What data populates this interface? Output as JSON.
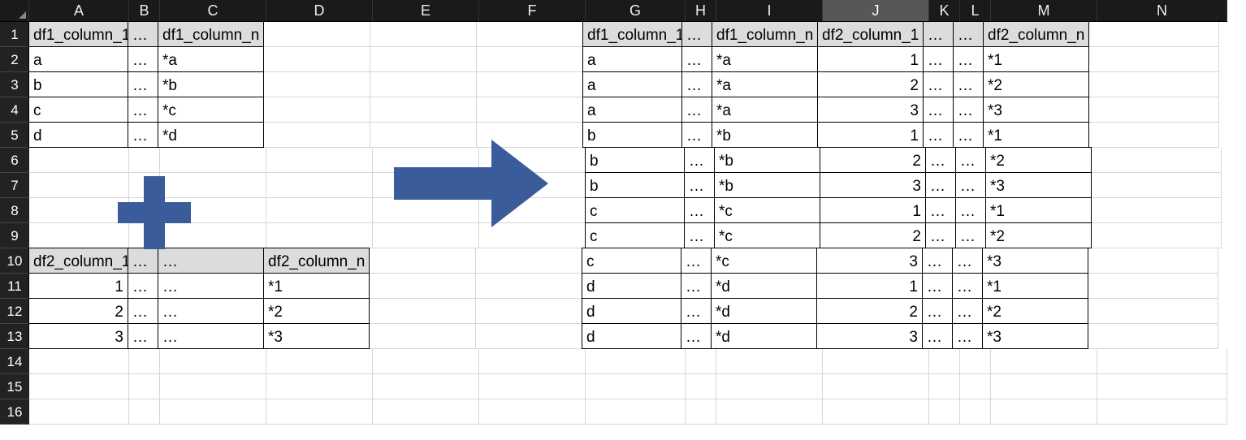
{
  "columns": {
    "A": "A",
    "B": "B",
    "C": "C",
    "D": "D",
    "E": "E",
    "F": "F",
    "G": "G",
    "H": "H",
    "I": "I",
    "J": "J",
    "K": "K",
    "L": "L",
    "M": "M",
    "N": "N"
  },
  "selected_column": "J",
  "row_labels": [
    "1",
    "2",
    "3",
    "4",
    "5",
    "6",
    "7",
    "8",
    "9",
    "10",
    "11",
    "12",
    "13",
    "14",
    "15",
    "16"
  ],
  "left": {
    "df1": {
      "header": {
        "A": "df1_column_1",
        "B": "…",
        "C": "df1_column_n"
      },
      "rows": [
        {
          "A": "a",
          "B": "…",
          "C": "*a"
        },
        {
          "A": "b",
          "B": "…",
          "C": "*b"
        },
        {
          "A": "c",
          "B": "…",
          "C": "*c"
        },
        {
          "A": "d",
          "B": "…",
          "C": "*d"
        }
      ]
    },
    "df2": {
      "header": {
        "A": "df2_column_1",
        "B": "…",
        "C": "…",
        "D": "df2_column_n"
      },
      "rows": [
        {
          "A": "1",
          "B": "…",
          "C": "…",
          "D": "*1"
        },
        {
          "A": "2",
          "B": "…",
          "C": "…",
          "D": "*2"
        },
        {
          "A": "3",
          "B": "…",
          "C": "…",
          "D": "*3"
        }
      ]
    }
  },
  "right": {
    "header": {
      "G": "df1_column_1",
      "H": "…",
      "I": "df1_column_n",
      "J": "df2_column_1",
      "K": "…",
      "L": "…",
      "M": "df2_column_n"
    },
    "rows": [
      {
        "G": "a",
        "H": "…",
        "I": "*a",
        "J": "1",
        "K": "…",
        "L": "…",
        "M": "*1"
      },
      {
        "G": "a",
        "H": "…",
        "I": "*a",
        "J": "2",
        "K": "…",
        "L": "…",
        "M": "*2"
      },
      {
        "G": "a",
        "H": "…",
        "I": "*a",
        "J": "3",
        "K": "…",
        "L": "…",
        "M": "*3"
      },
      {
        "G": "b",
        "H": "…",
        "I": "*b",
        "J": "1",
        "K": "…",
        "L": "…",
        "M": "*1"
      },
      {
        "G": "b",
        "H": "…",
        "I": "*b",
        "J": "2",
        "K": "…",
        "L": "…",
        "M": "*2"
      },
      {
        "G": "b",
        "H": "…",
        "I": "*b",
        "J": "3",
        "K": "…",
        "L": "…",
        "M": "*3"
      },
      {
        "G": "c",
        "H": "…",
        "I": "*c",
        "J": "1",
        "K": "…",
        "L": "…",
        "M": "*1"
      },
      {
        "G": "c",
        "H": "…",
        "I": "*c",
        "J": "2",
        "K": "…",
        "L": "…",
        "M": "*2"
      },
      {
        "G": "c",
        "H": "…",
        "I": "*c",
        "J": "3",
        "K": "…",
        "L": "…",
        "M": "*3"
      },
      {
        "G": "d",
        "H": "…",
        "I": "*d",
        "J": "1",
        "K": "…",
        "L": "…",
        "M": "*1"
      },
      {
        "G": "d",
        "H": "…",
        "I": "*d",
        "J": "2",
        "K": "…",
        "L": "…",
        "M": "*2"
      },
      {
        "G": "d",
        "H": "…",
        "I": "*d",
        "J": "3",
        "K": "…",
        "L": "…",
        "M": "*3"
      }
    ]
  },
  "icons": {
    "plus_color": "#3a5c9b",
    "arrow_color": "#3a5c9b"
  }
}
